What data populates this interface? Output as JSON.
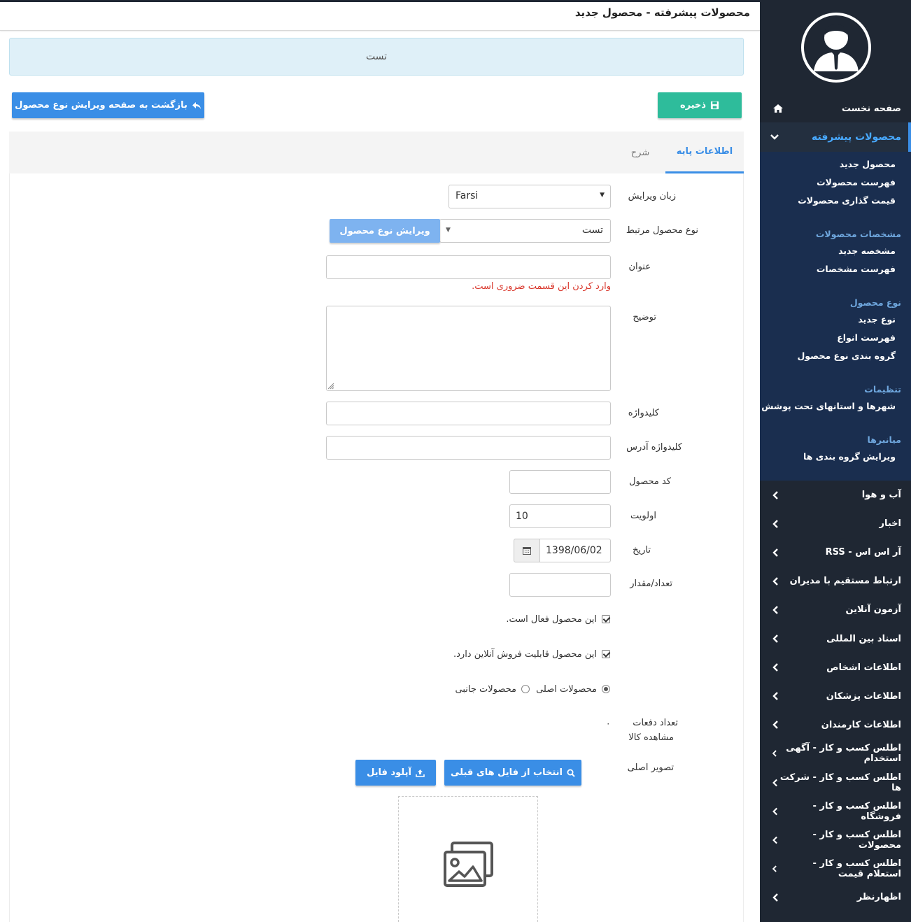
{
  "page": {
    "title": "محصولات پیشرفته - محصول جدید",
    "alert_text": "تست"
  },
  "actions": {
    "save_label": "ذخیره",
    "back_label": "بازگشت به صفحه ویرایش نوع محصول"
  },
  "tabs": [
    {
      "label": "اطلاعات پایه",
      "active": true
    },
    {
      "label": "شرح",
      "active": false
    }
  ],
  "form": {
    "edit_language": {
      "label": "زبان ویرایش",
      "value": "Farsi"
    },
    "product_type": {
      "label": "نوع محصول مرتبط",
      "value": "تست",
      "button": "ویرایش نوع محصول"
    },
    "title": {
      "label": "عنوان",
      "value": "",
      "error": "وارد کردن این قسمت ضروری است."
    },
    "description": {
      "label": "توضیح",
      "value": ""
    },
    "keyword": {
      "label": "کلیدواژه",
      "value": ""
    },
    "keyword_address": {
      "label": "کلیدواژه آدرس",
      "value": ""
    },
    "product_code": {
      "label": "کد محصول",
      "value": ""
    },
    "priority": {
      "label": "اولویت",
      "value": "10"
    },
    "date": {
      "label": "تاریخ",
      "value": "1398/06/02"
    },
    "quantity": {
      "label": "تعداد/مقدار",
      "value": ""
    },
    "active_checkbox": {
      "label": "این محصول فعال است.",
      "checked": true
    },
    "online_sale_checkbox": {
      "label": "این محصول قابلیت فروش آنلاین دارد.",
      "checked": true
    },
    "product_kind": {
      "options": [
        {
          "label": "محصولات اصلی",
          "selected": true
        },
        {
          "label": "محصولات جانبی",
          "selected": false
        }
      ]
    },
    "views": {
      "label_line1": "تعداد دفعات",
      "label_line2": "مشاهده کالا",
      "value": "۰"
    },
    "main_image": {
      "label": "تصویر اصلی",
      "choose_label": "انتخاب از فایل های قبلی",
      "upload_label": "آپلود فایل"
    }
  },
  "sidebar": {
    "home": "صفحه نخست",
    "active_section": "محصولات پیشرفته",
    "submenu": {
      "items_a": [
        "محصول جدید",
        "فهرست محصولات",
        "قیمت گذاری محصولات"
      ],
      "head_b": "مشخصات محصولات",
      "items_b": [
        "مشخصه جدید",
        "فهرست مشخصات"
      ],
      "head_c": "نوع محصول",
      "items_c": [
        "نوع جدید",
        "فهرست انواع",
        "گروه بندی نوع محصول"
      ],
      "head_d": "تنظیمات",
      "items_d": [
        "شهرها و استانهای تحت پوشش"
      ],
      "head_e": "میانبرها",
      "items_e": [
        "ویرایش گروه بندی ها"
      ]
    },
    "menu": [
      "آب و هوا",
      "اخبار",
      "آر اس اس - RSS",
      "ارتباط مستقیم با مدیران",
      "آزمون آنلاین",
      "اسناد بین المللی",
      "اطلاعات اشخاص",
      "اطلاعات پزشکان",
      "اطلاعات کارمندان",
      "اطلس کسب و کار - آگهی استخدام",
      "اطلس کسب و کار - شرکت ها",
      "اطلس کسب و کار - فروشگاه",
      "اطلس کسب و کار - محصولات",
      "اطلس کسب و کار - استعلام قیمت",
      "اظهارنظر"
    ]
  },
  "colors": {
    "sidebar_bg": "#1f2733",
    "submenu_bg": "#1a2e4f",
    "accent_blue": "#3a8ee6",
    "save_green": "#2ebc9b",
    "error_red": "#d9362b"
  }
}
